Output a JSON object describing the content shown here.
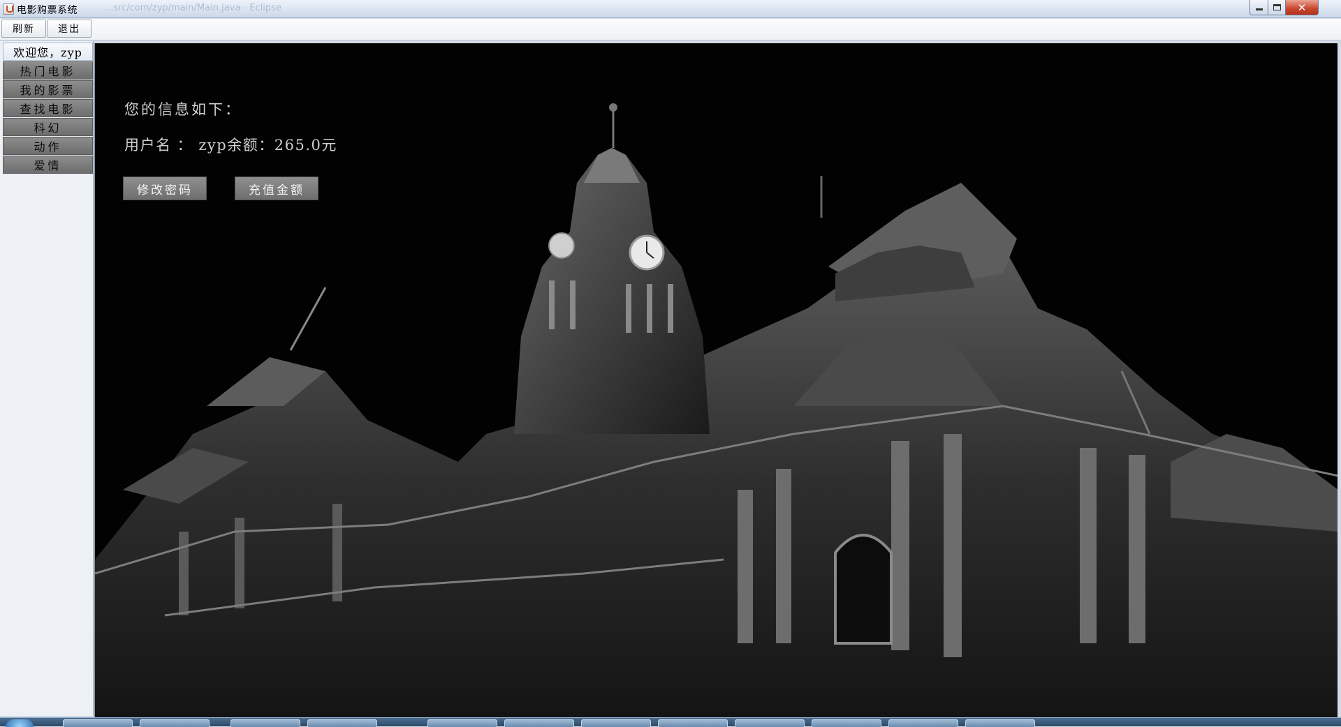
{
  "window": {
    "title": "电影购票系统",
    "ghost_text_1": "...src/com/zyp/main/Main.java - Eclipse",
    "min_label": "",
    "max_label": "",
    "close_label": "✕"
  },
  "toolbar": {
    "refresh_label": "刷新",
    "logout_label": "退出"
  },
  "sidebar": {
    "welcome": "欢迎您，zyp",
    "items": [
      {
        "label": "热门电影"
      },
      {
        "label": "我的影票"
      },
      {
        "label": "查找电影"
      },
      {
        "label": "科幻"
      },
      {
        "label": "动作"
      },
      {
        "label": "爱情"
      }
    ]
  },
  "content": {
    "heading": "您的信息如下：",
    "user_line": "用户名 ： zyp余额：265.0元",
    "change_password_label": "修改密码",
    "recharge_label": "充值金额"
  },
  "colors": {
    "accent_button": "#7f7f7f",
    "panel_bg": "#020202",
    "text": "#cfcfcf",
    "close_red": "#c8442d"
  }
}
